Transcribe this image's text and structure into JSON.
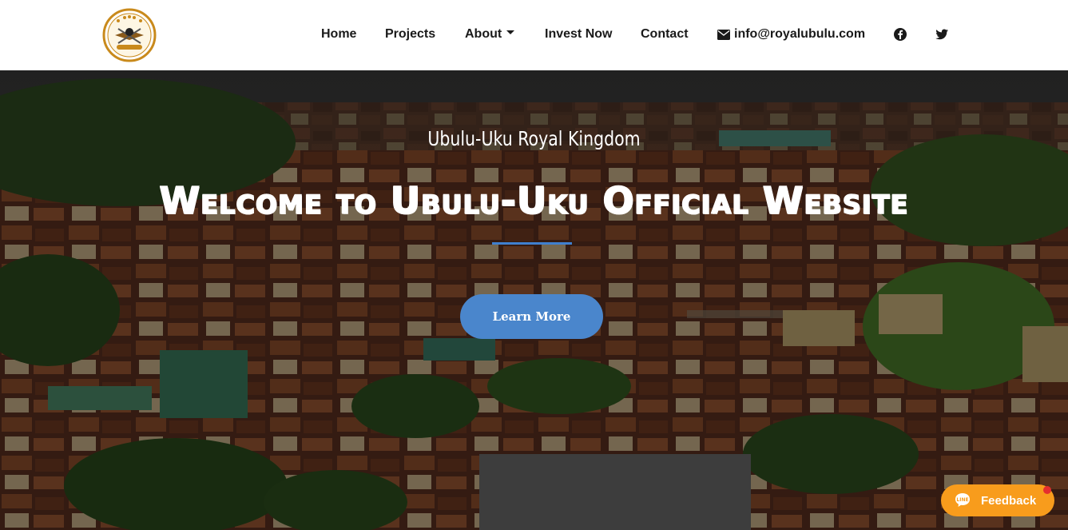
{
  "nav": {
    "items": [
      {
        "label": "Home"
      },
      {
        "label": "Projects"
      },
      {
        "label": "About"
      },
      {
        "label": "Invest Now"
      },
      {
        "label": "Contact"
      }
    ],
    "email": "info@royalubulu.com",
    "icons": {
      "logo": "royal-crest-logo",
      "email": "envelope-icon",
      "facebook": "facebook-icon",
      "twitter": "twitter-icon",
      "dropdown": "caret-down-icon"
    }
  },
  "hero": {
    "subtitle": "Ubulu-Uku Royal Kingdom",
    "headline": "Welcome to Ubulu-Uku Official Website",
    "button_label": "Learn More"
  },
  "feedback": {
    "label": "Feedback",
    "icon": "chat-bubble-icon"
  },
  "colors": {
    "accent": "#4a86cc",
    "feedback": "#f89c1c",
    "divider": "#3f7fcf"
  }
}
